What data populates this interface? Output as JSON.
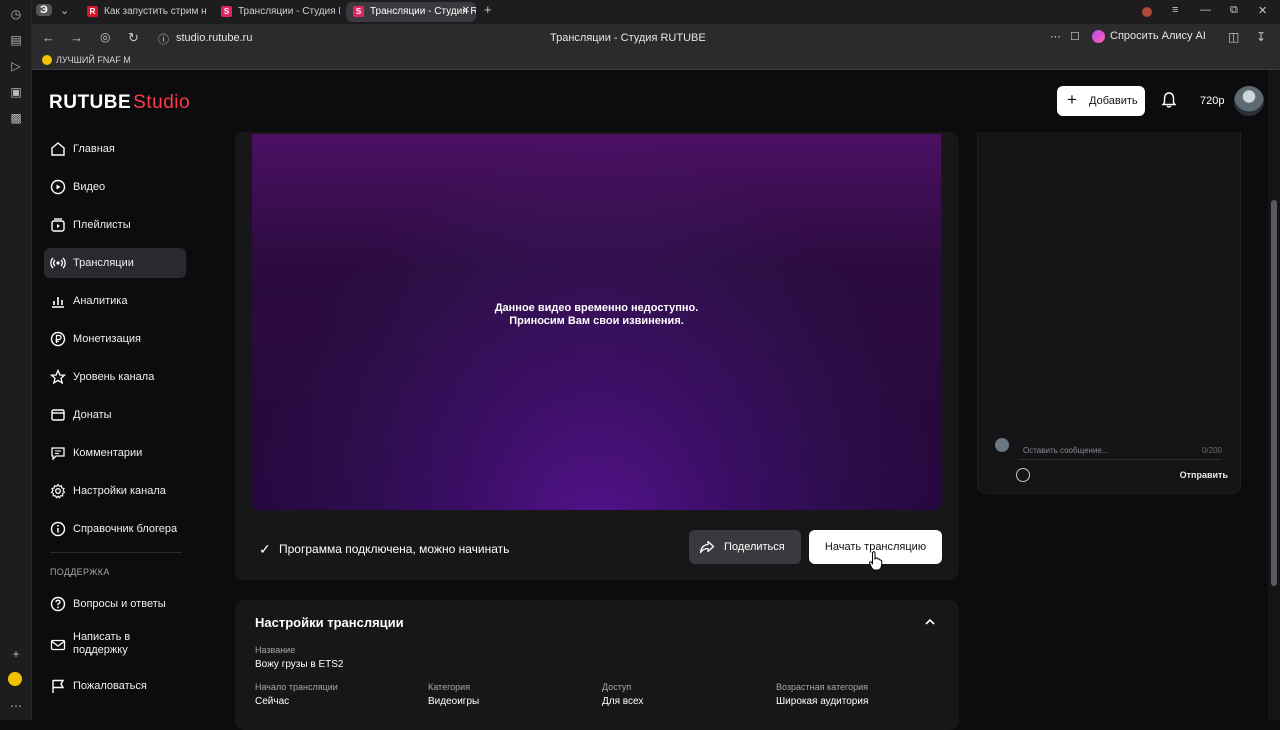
{
  "browser": {
    "tabs": [
      {
        "title": "Как запустить стрим на р",
        "favicon": "R"
      },
      {
        "title": "Трансляции - Студия RUT",
        "favicon": "S"
      },
      {
        "title": "Трансляции - Студия R",
        "favicon": "S"
      }
    ],
    "url": "studio.rutube.ru",
    "page_title": "Трансляции - Студия RUTUBE",
    "alice_label": "Спросить Алису AI",
    "bookmark": "ЛУЧШИЙ FNAF М"
  },
  "header": {
    "logo_main": "RUTUBE",
    "logo_sub": "Studio",
    "add_label": "Добавить",
    "quality": "720p"
  },
  "sidebar": {
    "items": [
      {
        "label": "Главная",
        "icon": "home-icon"
      },
      {
        "label": "Видео",
        "icon": "video-icon"
      },
      {
        "label": "Плейлисты",
        "icon": "playlist-icon"
      },
      {
        "label": "Трансляции",
        "icon": "broadcast-icon",
        "active": true
      },
      {
        "label": "Аналитика",
        "icon": "analytics-icon"
      },
      {
        "label": "Монетизация",
        "icon": "monetization-icon"
      },
      {
        "label": "Уровень канала",
        "icon": "star-icon"
      },
      {
        "label": "Донаты",
        "icon": "donate-icon"
      },
      {
        "label": "Комментарии",
        "icon": "comment-icon"
      },
      {
        "label": "Настройки канала",
        "icon": "gear-icon"
      },
      {
        "label": "Справочник блогера",
        "icon": "info-icon"
      }
    ],
    "support_label": "ПОДДЕРЖКА",
    "support_items": [
      {
        "label": "Вопросы и ответы",
        "icon": "question-icon"
      },
      {
        "label": "Написать в поддержку",
        "icon": "mail-icon"
      },
      {
        "label": "Пожаловаться",
        "icon": "flag-icon"
      }
    ]
  },
  "player": {
    "unavailable_line1": "Данное видео временно недоступно.",
    "unavailable_line2": "Приносим Вам свои извинения.",
    "status": "Программа подключена, можно начинать",
    "share_label": "Поделиться",
    "start_label": "Начать трансляцию"
  },
  "chat": {
    "placeholder": "Оставить сообщение...",
    "counter": "0/200",
    "send_label": "Отправить"
  },
  "settings": {
    "title": "Настройки трансляции",
    "name_label": "Название",
    "name_value": "Вожу грузы в ETS2",
    "fields": [
      {
        "label": "Начало трансляции",
        "value": "Сейчас"
      },
      {
        "label": "Категория",
        "value": "Видеоигры"
      },
      {
        "label": "Доступ",
        "value": "Для всех"
      },
      {
        "label": "Возрастная категория",
        "value": "Широкая аудитория"
      }
    ]
  },
  "colors": {
    "accent": "#ff3a4a",
    "background": "#0c0c0e",
    "card": "#17171a"
  }
}
